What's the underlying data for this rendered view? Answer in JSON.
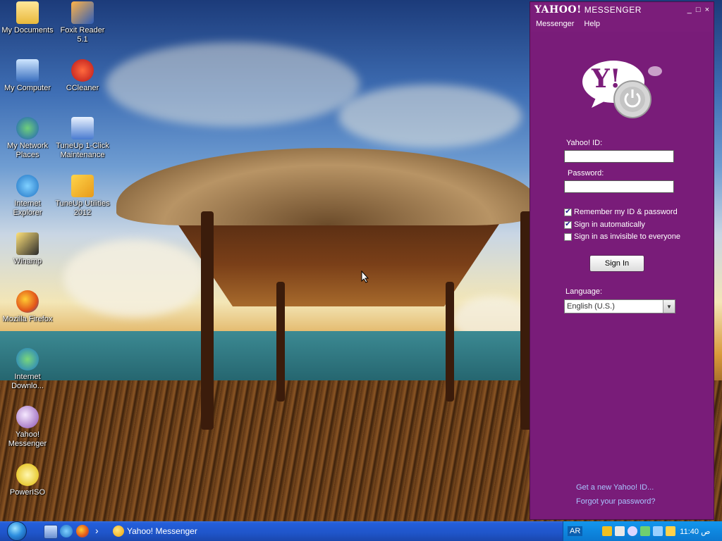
{
  "desktop": {
    "icons": [
      {
        "label": "My Documents",
        "icon": "folder-documents-icon"
      },
      {
        "label": "Foxit Reader 5.1",
        "icon": "foxit-reader-icon"
      },
      {
        "label": "My Computer",
        "icon": "computer-icon"
      },
      {
        "label": "CCleaner",
        "icon": "ccleaner-icon"
      },
      {
        "label": "My Network Places",
        "icon": "network-places-icon"
      },
      {
        "label": "TuneUp 1-Click Maintenance",
        "icon": "tuneup-maintenance-icon"
      },
      {
        "label": "Internet Explorer",
        "icon": "internet-explorer-icon"
      },
      {
        "label": "TuneUp Utilities 2012",
        "icon": "tuneup-utilities-icon"
      },
      {
        "label": "Winamp",
        "icon": "winamp-icon"
      },
      {
        "label": "Mozilla Firefox",
        "icon": "firefox-icon"
      },
      {
        "label": "Internet Downlo...",
        "icon": "internet-download-manager-icon"
      },
      {
        "label": "Yahoo! Messenger",
        "icon": "yahoo-messenger-icon"
      },
      {
        "label": "PowerISO",
        "icon": "poweriso-icon"
      }
    ]
  },
  "messenger": {
    "title_brand": "YAHOO!",
    "title_product": "MESSENGER",
    "window_buttons": {
      "minimize": "_",
      "maximize": "□",
      "close": "×"
    },
    "menu": [
      "Messenger",
      "Help"
    ],
    "logo_text": "Y!",
    "yahoo_id_label": "Yahoo! ID:",
    "yahoo_id_value": "",
    "password_label": "Password:",
    "password_value": "",
    "options": [
      {
        "label": "Remember my ID & password",
        "checked": true
      },
      {
        "label": "Sign in automatically",
        "checked": true
      },
      {
        "label": "Sign in as invisible to everyone",
        "checked": false
      }
    ],
    "sign_in_label": "Sign In",
    "language_label": "Language:",
    "language_value": "English (U.S.)",
    "get_id_link": "Get a new Yahoo! ID...",
    "forgot_password_link": "Forgot your password?",
    "colors": {
      "window": "#7b1d7a",
      "link": "#a9c6ff"
    }
  },
  "taskbar": {
    "quick_launch": [
      "show-desktop-icon",
      "internet-explorer-icon",
      "firefox-icon"
    ],
    "expand_glyph": "›",
    "active_task": "Yahoo! Messenger",
    "language_indicator": "AR",
    "clock": "11:40 ص"
  }
}
